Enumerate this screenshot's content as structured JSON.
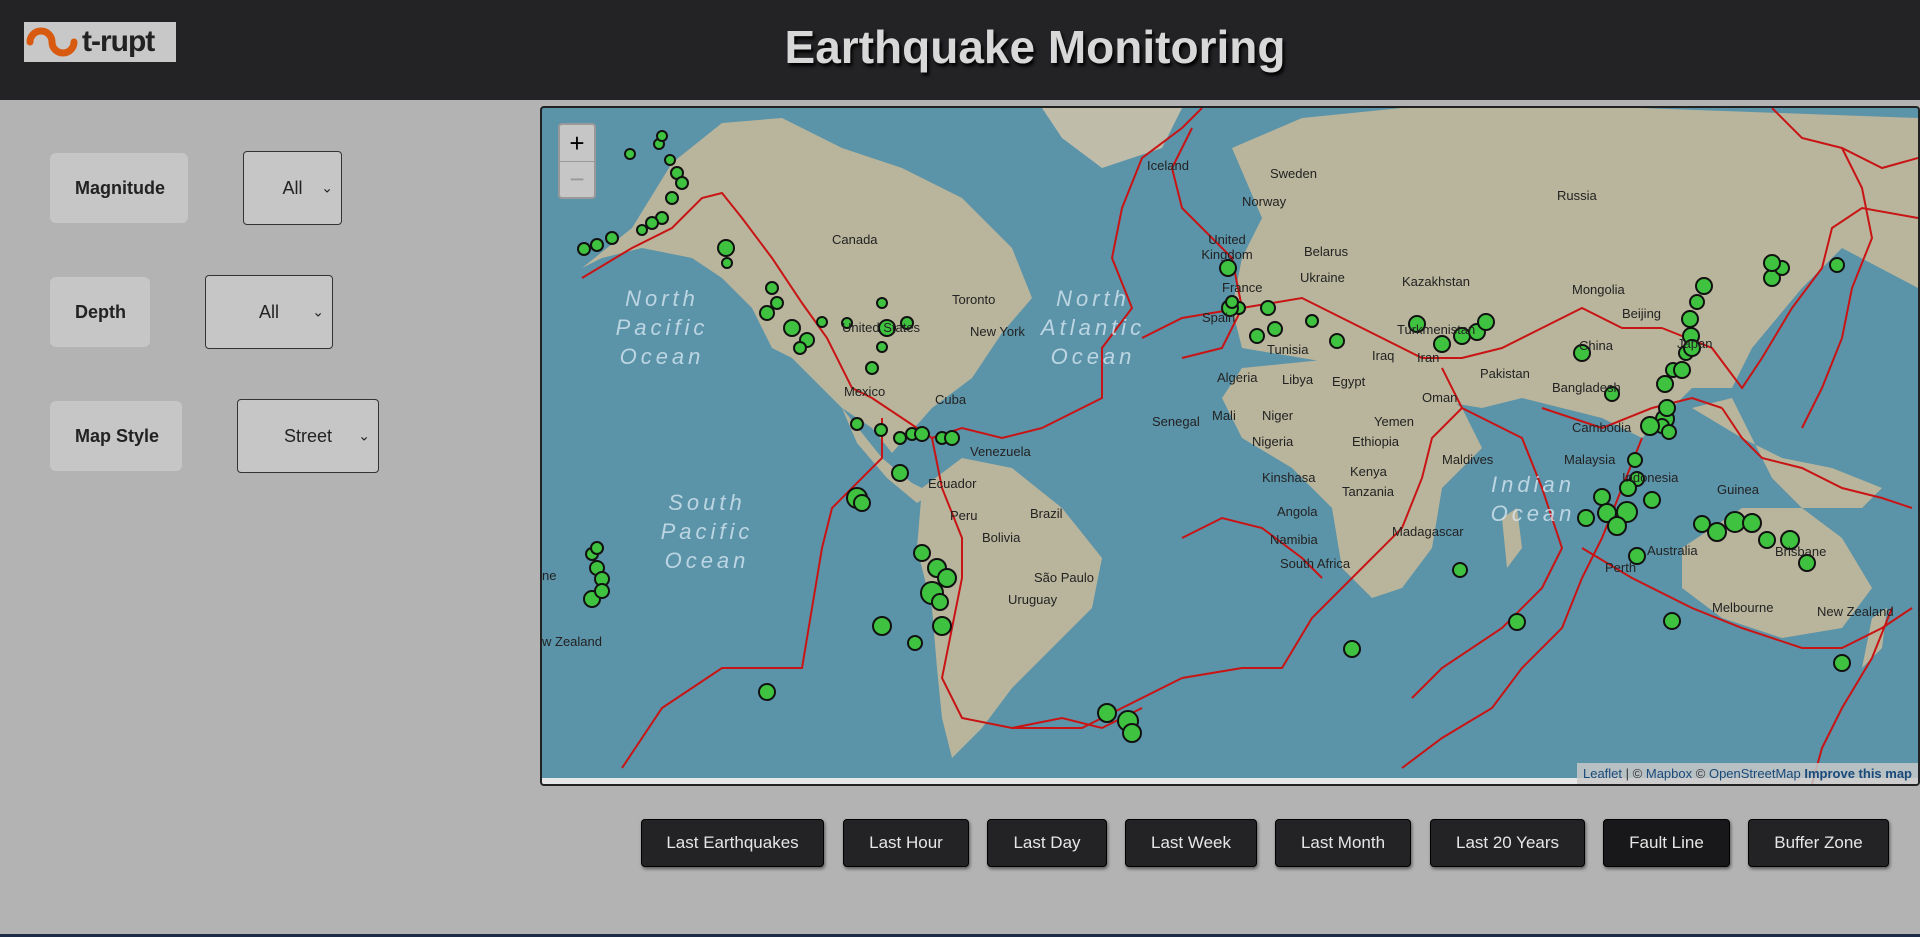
{
  "header": {
    "logo_text": "t-rupt",
    "title": "Earthquake Monitoring"
  },
  "controls": {
    "magnitude": {
      "label": "Magnitude",
      "value": "All"
    },
    "depth": {
      "label": "Depth",
      "value": "All"
    },
    "map_style": {
      "label": "Map Style",
      "value": "Street"
    }
  },
  "map": {
    "zoom_in": "+",
    "zoom_out": "−",
    "attribution": {
      "leaflet": "Leaflet",
      "sep1": "| ©",
      "mapbox": "Mapbox",
      "sep2": "©",
      "osm": "OpenStreetMap",
      "improve": "Improve this map"
    },
    "place_labels": [
      "Iceland",
      "Sweden",
      "Norway",
      "Russia",
      "United Kingdom",
      "Belarus",
      "Ukraine",
      "Kazakhstan",
      "France",
      "Mongolia",
      "Spain",
      "Turkmenistan",
      "Beijing",
      "Tunisia",
      "Iraq",
      "Iran",
      "China",
      "Algeria",
      "Libya",
      "Egypt",
      "Pakistan",
      "Bangladesh",
      "Oman",
      "Senegal",
      "Mali",
      "Niger",
      "Yemen",
      "Nigeria",
      "Ethiopia",
      "Cambodia",
      "Maldives",
      "Malaysia",
      "Kenya",
      "Indonesia",
      "Kinshasa",
      "Tanzania",
      "Angola",
      "Madagascar",
      "Namibia",
      "South Africa",
      "Australia",
      "Brisbane",
      "Perth",
      "Melbourne",
      "New Zealand",
      "Canada",
      "Toronto",
      "New York",
      "United States",
      "Mexico",
      "Cuba",
      "Venezuela",
      "Ecuador",
      "Peru",
      "Brazil",
      "Bolivia",
      "São Paulo",
      "Uruguay",
      "w Zealand",
      "ne",
      "Guinea",
      "Japan"
    ],
    "ocean_labels": [
      "North Pacific Ocean",
      "North Atlantic Ocean",
      "South Pacific Ocean",
      "Indian Ocean"
    ],
    "colors": {
      "water": "#5b93a8",
      "land": "#b9b59c",
      "fault": "#c81414",
      "quake": "#3fc23f"
    }
  },
  "buttons": [
    "Last Earthquakes",
    "Last Hour",
    "Last Day",
    "Last Week",
    "Last Month",
    "Last 20 Years",
    "Fault Line",
    "Buffer Zone"
  ]
}
